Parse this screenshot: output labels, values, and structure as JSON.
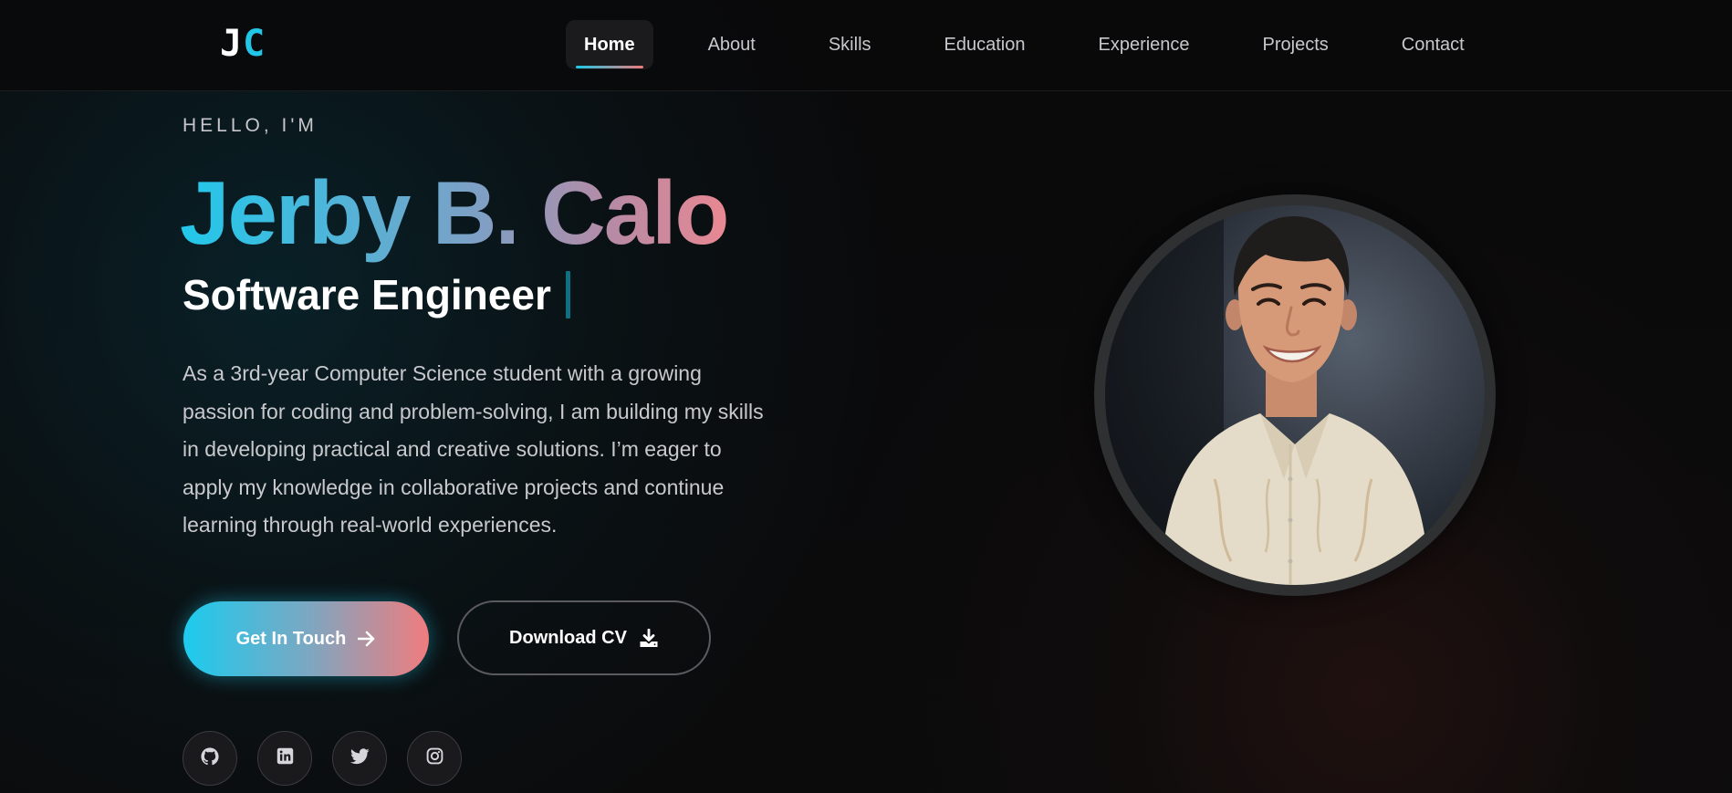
{
  "nav": {
    "logo": {
      "first": "J",
      "second": "C"
    },
    "items": [
      {
        "label": "Home",
        "active": true
      },
      {
        "label": "About"
      },
      {
        "label": "Skills"
      },
      {
        "label": "Education"
      },
      {
        "label": "Experience"
      },
      {
        "label": "Projects"
      },
      {
        "label": "Contact"
      }
    ]
  },
  "hero": {
    "greeting": "HELLO, I'M",
    "name": "Jerby B. Calo",
    "role": "Software Engineer",
    "description": "As a 3rd-year Computer Science student with a growing passion for coding and problem-solving, I am building my skills in developing practical and creative solutions. I’m eager to apply my knowledge in collaborative projects and continue learning through real-world experiences.",
    "primary_button": {
      "label": "Get In Touch",
      "icon": "arrow-right-icon"
    },
    "secondary_button": {
      "label": "Download CV",
      "icon": "download-icon"
    },
    "socials": [
      {
        "icon": "github-icon"
      },
      {
        "icon": "linkedin-icon"
      },
      {
        "icon": "twitter-icon"
      },
      {
        "icon": "instagram-icon"
      }
    ]
  },
  "theme": {
    "background": "#0b0b0c",
    "accent_cyan": "#22c7e8",
    "accent_coral": "#f07a7a",
    "text_muted": "#c9c9cd"
  }
}
